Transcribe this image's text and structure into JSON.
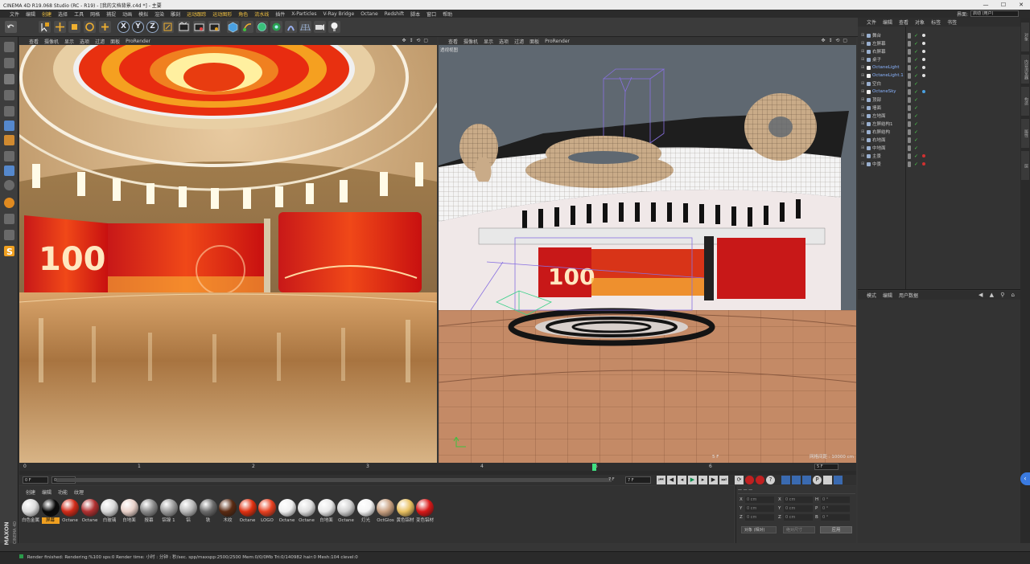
{
  "window": {
    "title": "CINEMA 4D R19.068 Studio (RC - R19) - [我的文档背景.c4d *] - 主要",
    "btn_min": "—",
    "btn_max": "☐",
    "btn_close": "✕"
  },
  "menu": {
    "items": [
      "文件",
      "编辑",
      "创建",
      "选择",
      "工具",
      "网格",
      "捕捉",
      "动画",
      "模拟",
      "渲染",
      "雕刻",
      "运动跟踪",
      "运动图形",
      "角色",
      "流水线",
      "插件",
      "X-Particles",
      "V-Ray Bridge",
      "Octane",
      "Redshift",
      "脚本",
      "窗口",
      "帮助"
    ],
    "highlight": [
      2,
      11,
      12,
      13,
      14
    ]
  },
  "layout": {
    "label": "界面:",
    "value": "启动 (用户)"
  },
  "toolbar": {
    "x": "X",
    "y": "Y",
    "z": "Z"
  },
  "viewport_left": {
    "menu": [
      "查看",
      "摄像机",
      "显示",
      "选项",
      "过滤",
      "面板",
      "ProRender"
    ],
    "screen_number": "100"
  },
  "viewport_right": {
    "menu": [
      "查看",
      "摄像机",
      "显示",
      "选项",
      "过滤",
      "面板",
      "ProRender"
    ],
    "label": "透视视图",
    "grid_info": "网格间距 : 10000 cm",
    "frame_badge": "5 F",
    "screen_number": "100"
  },
  "timeline": {
    "ticks": [
      "0",
      "1",
      "2",
      "3",
      "4",
      "5",
      "6",
      "7"
    ],
    "frame_end_box": "5 F",
    "current": "0 F",
    "start_field": "0 F",
    "end_field": "7 F",
    "mid_field": "7 F"
  },
  "materials": {
    "tabs": [
      "创建",
      "编辑",
      "功能",
      "纹理"
    ],
    "items": [
      {
        "label": "白色金属",
        "color": "#dcdcdc"
      },
      {
        "label": "屏幕",
        "color": "#0a0a0a",
        "selected": true
      },
      {
        "label": "Octane",
        "color": "#d02a18"
      },
      {
        "label": "Octane",
        "color": "#b03030"
      },
      {
        "label": "白玻璃",
        "color": "#d8d8d8"
      },
      {
        "label": "白地面",
        "color": "#e8d0c8"
      },
      {
        "label": "报幕",
        "color": "#8a8a8a"
      },
      {
        "label": "铝镍 1",
        "color": "#9a9a9a"
      },
      {
        "label": "铝",
        "color": "#b8b8b8"
      },
      {
        "label": "铁",
        "color": "#6a6a6a"
      },
      {
        "label": "木纹",
        "color": "#5a2a12"
      },
      {
        "label": "Octane",
        "color": "#e03010"
      },
      {
        "label": "LOGO",
        "color": "#e84020"
      },
      {
        "label": "Octane",
        "color": "#f0f0f0"
      },
      {
        "label": "Octane",
        "color": "#dedede"
      },
      {
        "label": "白地面",
        "color": "#e8e8e8"
      },
      {
        "label": "Octane",
        "color": "#d0d0d0"
      },
      {
        "label": "灯光",
        "color": "#f4f4f4"
      },
      {
        "label": "OctGlos",
        "color": "#c8a080"
      },
      {
        "label": "黄色铝材",
        "color": "#e8c060"
      },
      {
        "label": "变色铝材",
        "color": "#d81818"
      }
    ]
  },
  "coords": {
    "rows": [
      {
        "a": "X",
        "av": "0 cm",
        "b": "X",
        "bv": "0 cm",
        "c": "H",
        "cv": "0 °"
      },
      {
        "a": "Y",
        "av": "0 cm",
        "b": "Y",
        "bv": "0 cm",
        "c": "P",
        "cv": "0 °"
      },
      {
        "a": "Z",
        "av": "0 cm",
        "b": "Z",
        "bv": "0 cm",
        "c": "B",
        "cv": "0 °"
      }
    ],
    "mode_left": "对象 (相对)",
    "mode_right": "绝对尺寸",
    "apply": "应用"
  },
  "objects": {
    "menu": [
      "文件",
      "编辑",
      "查看",
      "对象",
      "标签",
      "书签"
    ],
    "rows": [
      {
        "name": "舞台",
        "color": "#c8c8c8"
      },
      {
        "name": "左屏幕",
        "color": "#c8c8c8"
      },
      {
        "name": "右屏幕",
        "color": "#c8c8c8"
      },
      {
        "name": "桌子",
        "color": "#c8c8c8"
      },
      {
        "name": "OctaneLight",
        "color": "#8ab4ff"
      },
      {
        "name": "OctaneLight.1",
        "color": "#8ab4ff"
      },
      {
        "name": "空白",
        "color": "#c8c8c8"
      },
      {
        "name": "OctaneSky",
        "color": "#8ab4ff"
      },
      {
        "name": "顶部",
        "color": "#c8c8c8"
      },
      {
        "name": "墙面",
        "color": "#c8c8c8"
      },
      {
        "name": "左地面",
        "color": "#c8c8c8"
      },
      {
        "name": "左屏结构1",
        "color": "#c8c8c8"
      },
      {
        "name": "右屏结构",
        "color": "#c8c8c8"
      },
      {
        "name": "右地面",
        "color": "#c8c8c8"
      },
      {
        "name": "中地面",
        "color": "#c8c8c8"
      },
      {
        "name": "主景",
        "color": "#c8c8c8"
      },
      {
        "name": "中景",
        "color": "#c8c8c8"
      }
    ]
  },
  "attributes": {
    "menu": [
      "模式",
      "编辑",
      "用户数据"
    ]
  },
  "side_tabs": [
    "对象",
    "内容浏览器",
    "构造",
    "属性",
    "层"
  ],
  "status": {
    "text": "Render finished: Rendering:%100 sps:0 Render time: 小时 : 分钟 : 秒/sec. spp/maxspp:2500/2500 Mem:0/0/0Mb Tri:0/140982 hair:0 Mesh:104 clevel:0"
  },
  "brand": {
    "maxon": "MAXON",
    "c4d": "CINEMA 4D"
  }
}
